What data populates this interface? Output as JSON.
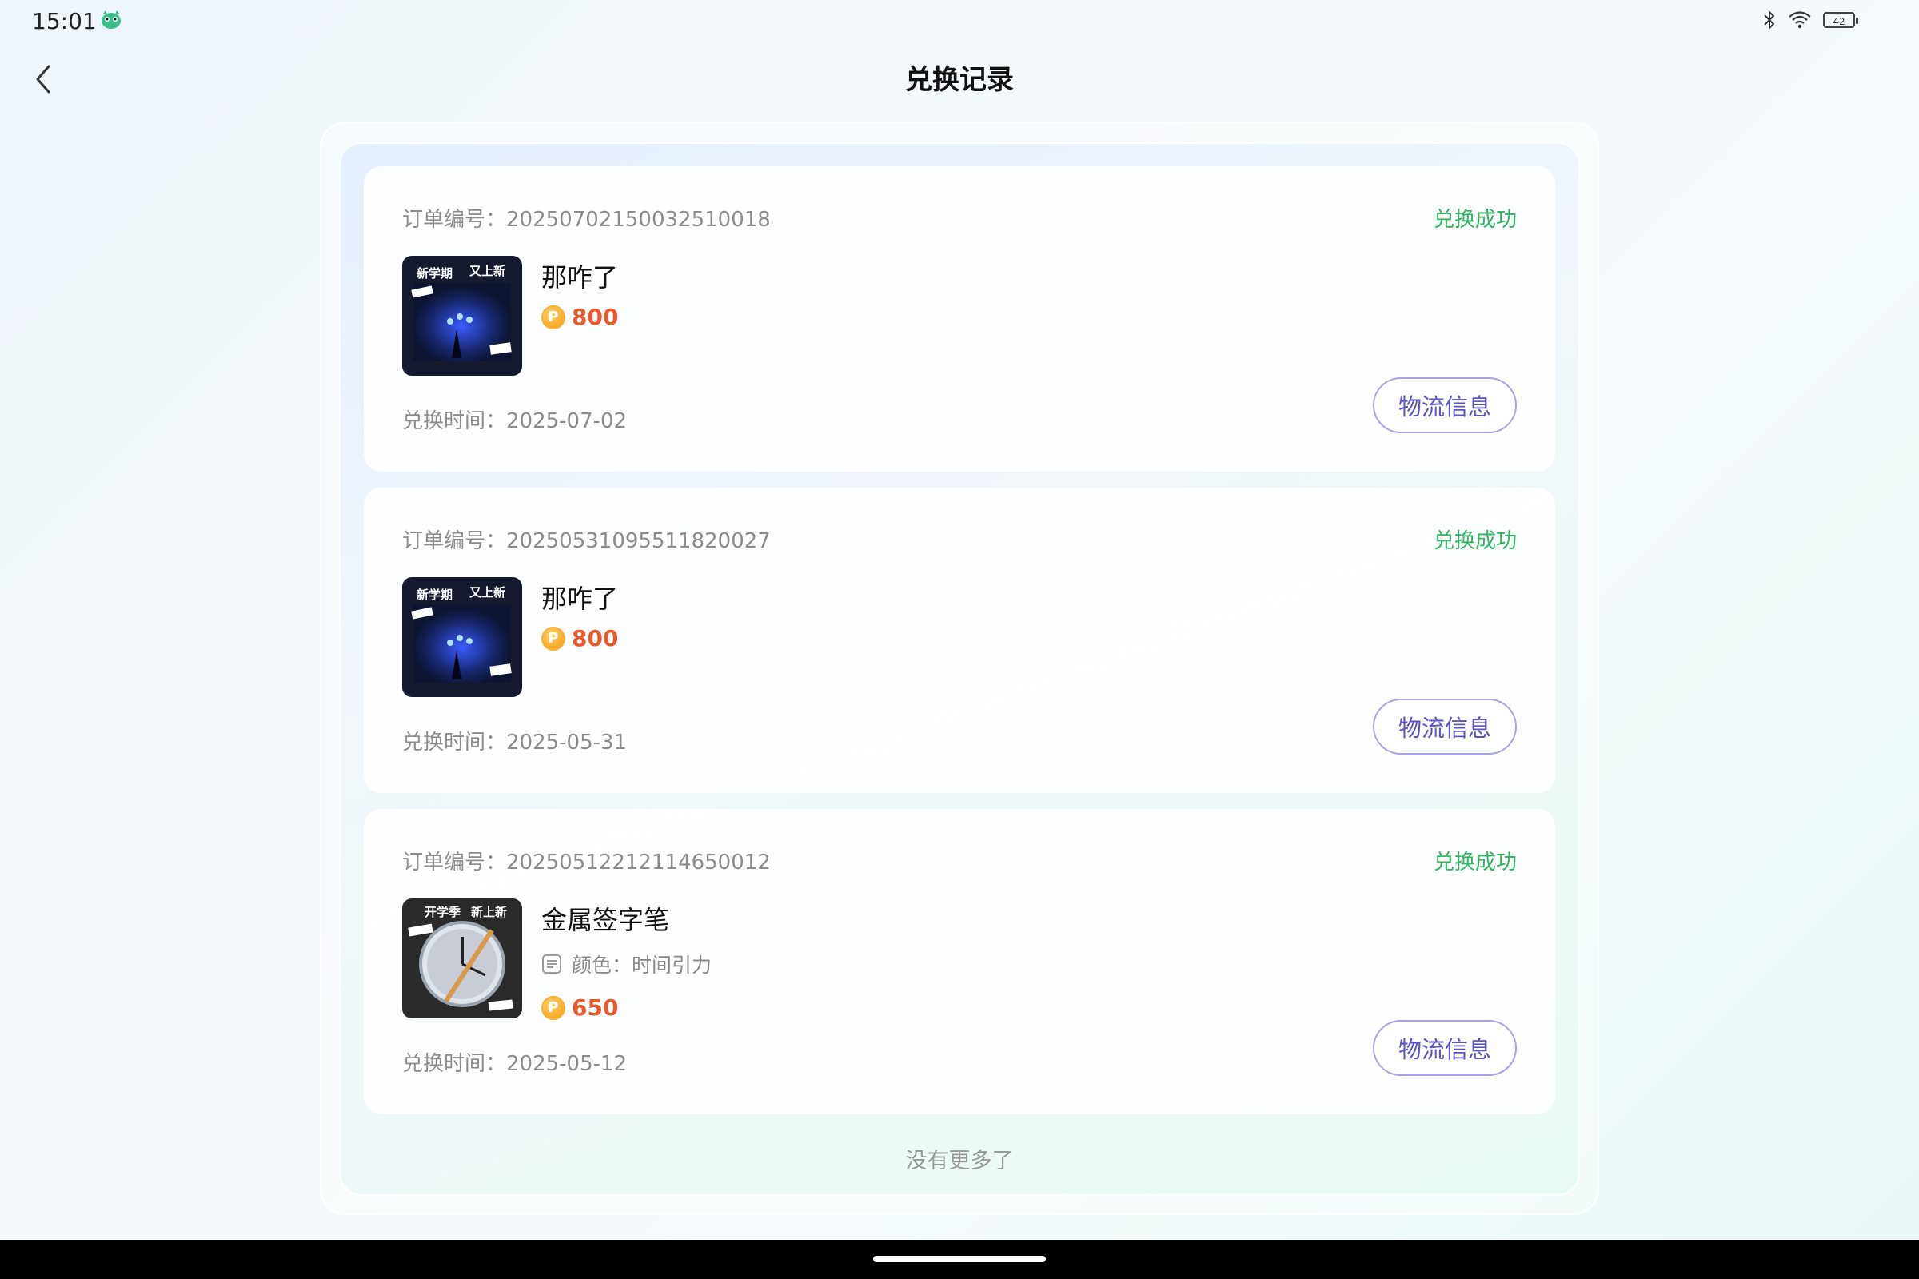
{
  "status_bar": {
    "time": "15:01",
    "battery": "42",
    "icons": [
      "app-mascot-icon",
      "bluetooth-icon",
      "wifi-icon",
      "battery-icon"
    ]
  },
  "header": {
    "title": "兑换记录",
    "back_icon": "chevron-left-icon"
  },
  "orders": [
    {
      "order_no": "订单编号：20250702150032510018",
      "status": "兑换成功",
      "product_name": "那咋了",
      "spec": "",
      "price": "800",
      "time": "兑换时间：2025-07-02",
      "button": "物流信息",
      "thumb_text": [
        "新学期",
        "又上新"
      ]
    },
    {
      "order_no": "订单编号：20250531095511820027",
      "status": "兑换成功",
      "product_name": "那咋了",
      "spec": "",
      "price": "800",
      "time": "兑换时间：2025-05-31",
      "button": "物流信息",
      "thumb_text": [
        "新学期",
        "又上新"
      ]
    },
    {
      "order_no": "订单编号：20250512212114650012",
      "status": "兑换成功",
      "product_name": "金属签字笔",
      "spec": "颜色：时间引力",
      "price": "650",
      "time": "兑换时间：2025-05-12",
      "button": "物流信息",
      "thumb_text": [
        "开学季",
        "新上新"
      ]
    }
  ],
  "footer": {
    "no_more": "没有更多了"
  },
  "colors": {
    "status_success": "#2fb45f",
    "price": "#e85a2a",
    "button_text": "#5a52c8",
    "button_border": "#a8a3e8"
  }
}
